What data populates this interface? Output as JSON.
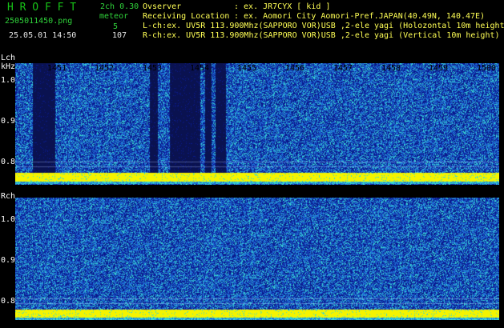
{
  "header": {
    "brand": "H R O F F T",
    "version": "2ch 0.30",
    "filename": "2505011450.png",
    "mode_label": "meteor",
    "count_top": "5",
    "datetime": "25.05.01 14:50",
    "count_bottom": "107",
    "observer_label": "Ovserver",
    "observer_value": ": ex. JR7CYX [ kid ]",
    "location_label": "Receiving Location",
    "location_value": ": ex. Aomori City Aomori-Pref.JAPAN(40.49N, 140.47E)",
    "lch_info": "L-ch:ex. UV5R 113.900Mhz(SAPPORO VOR)USB ,2-ele yagi (Holozontal 10m height)",
    "rch_info": "R-ch:ex. UV5R 113.900Mhz(SAPPORO VOR)USB ,2-ele yagi (Vertical 10m height)"
  },
  "lch_panel": {
    "channel_label": "Lch",
    "unit_label": "kHz",
    "y_ticks": [
      "1.0",
      "0.9",
      "0.8"
    ],
    "time_ticks": [
      "1451",
      "1452",
      "1453",
      "1454",
      "1455",
      "1456",
      "1457",
      "1458",
      "1459",
      "1500"
    ]
  },
  "rch_panel": {
    "channel_label": "Rch",
    "y_ticks": [
      "1.0",
      "0.9",
      "0.8"
    ]
  },
  "colors": {
    "noise_low": "#0a1a8c",
    "noise_mid": "#1e6fd6",
    "noise_high": "#38d6d0",
    "carrier": "#f4f400",
    "dark_band": "#0a1250"
  }
}
